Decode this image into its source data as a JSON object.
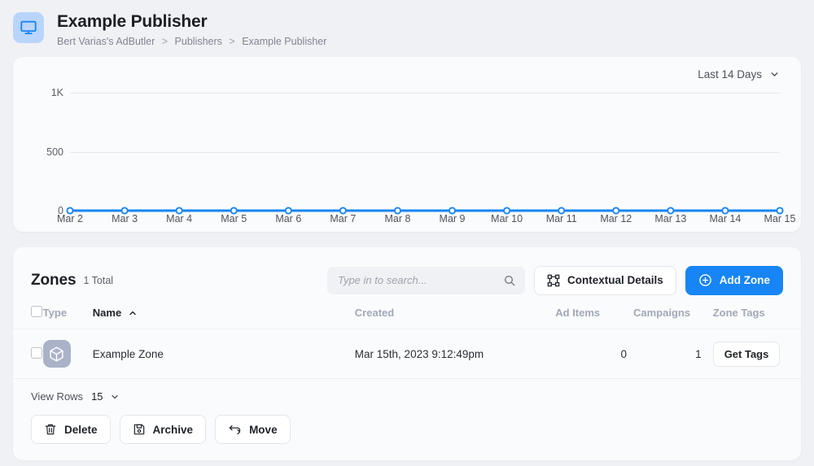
{
  "header": {
    "icon": "monitor-icon",
    "icon_bg": "#b9d5fb",
    "icon_color": "#1785f5",
    "title": "Example Publisher",
    "breadcrumb": [
      "Bert Varias's AdButler",
      "Publishers",
      "Example Publisher"
    ],
    "breadcrumb_separator": ">"
  },
  "chart_panel": {
    "range_label": "Last 14 Days",
    "range_caret": "chevron-down-icon"
  },
  "chart_data": {
    "type": "line",
    "title": "",
    "xlabel": "",
    "ylabel": "",
    "categories": [
      "Mar 2",
      "Mar 3",
      "Mar 4",
      "Mar 5",
      "Mar 6",
      "Mar 7",
      "Mar 8",
      "Mar 9",
      "Mar 10",
      "Mar 11",
      "Mar 12",
      "Mar 13",
      "Mar 14",
      "Mar 15"
    ],
    "values": [
      0,
      0,
      0,
      0,
      0,
      0,
      0,
      0,
      0,
      0,
      0,
      0,
      0,
      0
    ],
    "ylim": [
      0,
      1000
    ],
    "yticks": [
      0,
      500,
      1000
    ],
    "ytick_labels": [
      "0",
      "500",
      "1K"
    ],
    "grid": true,
    "legend": "none",
    "line_color": "#1785f5",
    "marker": "circle",
    "marker_fill": "#ffffff"
  },
  "zones": {
    "title": "Zones",
    "total_label": "1 Total",
    "search": {
      "placeholder": "Type in to search...",
      "value": "",
      "icon": "search-icon"
    },
    "contextual_details_label": "Contextual Details",
    "contextual_details_icon": "selection-frame-icon",
    "add_zone_label": "Add Zone",
    "add_zone_icon": "plus-circle-icon",
    "accent_color": "#1785f5",
    "columns": [
      {
        "key": "type",
        "label": "Type",
        "sorted": false
      },
      {
        "key": "name",
        "label": "Name",
        "sorted": true,
        "sort_icon": "chevron-up-icon"
      },
      {
        "key": "created",
        "label": "Created",
        "sorted": false
      },
      {
        "key": "ad_items",
        "label": "Ad Items",
        "sorted": false
      },
      {
        "key": "campaigns",
        "label": "Campaigns",
        "sorted": false
      },
      {
        "key": "zone_tags",
        "label": "Zone Tags",
        "sorted": false
      }
    ],
    "rows": [
      {
        "type_icon": "cube-icon",
        "name": "Example Zone",
        "created": "Mar 15th, 2023 9:12:49pm",
        "ad_items": "0",
        "campaigns": "1",
        "zone_tags_button": "Get Tags"
      }
    ],
    "footer": {
      "view_rows_label": "View Rows",
      "view_rows_value": "15",
      "view_rows_caret": "chevron-down-icon",
      "actions": [
        {
          "label": "Delete",
          "icon": "trash-icon"
        },
        {
          "label": "Archive",
          "icon": "floppy-disk-icon"
        },
        {
          "label": "Move",
          "icon": "move-arrows-icon"
        }
      ]
    }
  }
}
